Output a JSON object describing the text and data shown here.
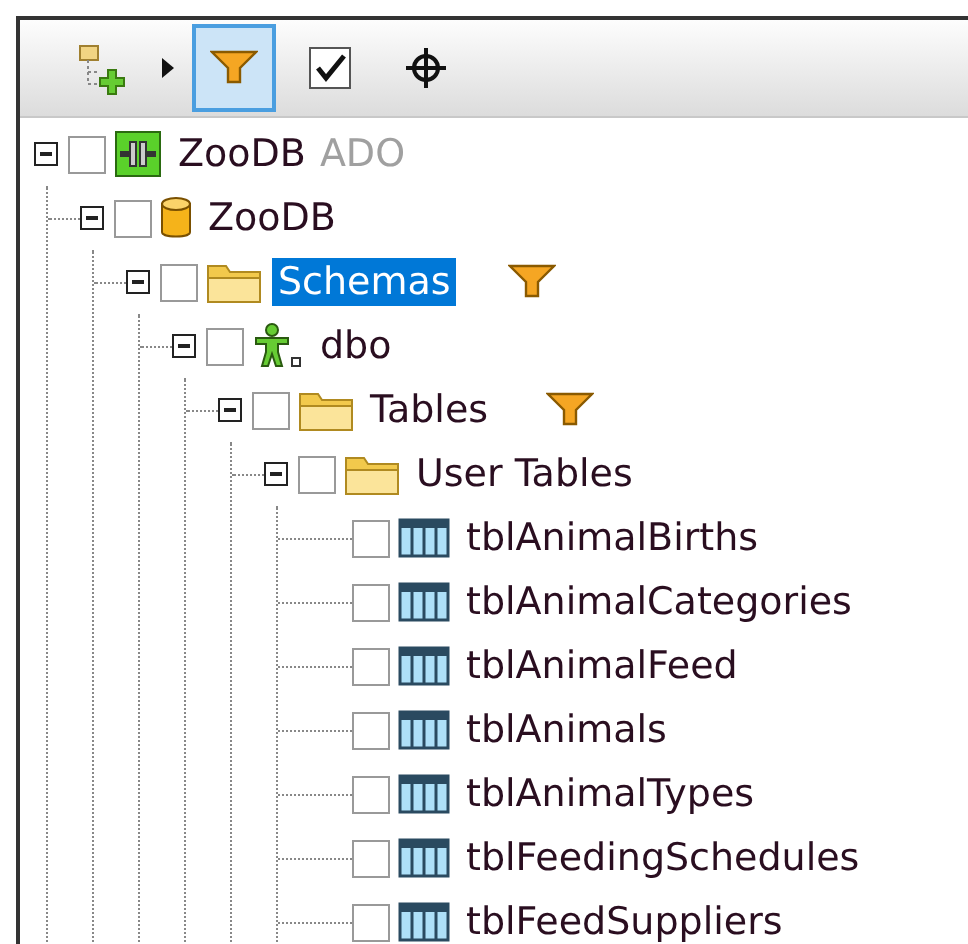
{
  "toolbar": [
    {
      "kind": "add-folder",
      "selected": false
    },
    {
      "kind": "dropdown",
      "selected": false
    },
    {
      "kind": "filter",
      "selected": true
    },
    {
      "kind": "check",
      "selected": false
    },
    {
      "kind": "locate",
      "selected": false
    }
  ],
  "tree": [
    {
      "kind": "connection",
      "label": "ZooDB",
      "suffix": "ADO",
      "expanded": true,
      "checked": false,
      "selected": false,
      "filtered": false,
      "children": [
        {
          "kind": "database",
          "label": "ZooDB",
          "expanded": true,
          "checked": false,
          "selected": false,
          "filtered": false,
          "children": [
            {
              "kind": "folder",
              "label": "Schemas",
              "expanded": true,
              "checked": false,
              "selected": true,
              "filtered": true,
              "children": [
                {
                  "kind": "schema",
                  "label": "dbo",
                  "expanded": true,
                  "checked": false,
                  "selected": false,
                  "filtered": false,
                  "children": [
                    {
                      "kind": "folder",
                      "label": "Tables",
                      "expanded": true,
                      "checked": false,
                      "selected": false,
                      "filtered": true,
                      "children": [
                        {
                          "kind": "folder",
                          "label": "User Tables",
                          "expanded": true,
                          "checked": false,
                          "selected": false,
                          "filtered": false,
                          "children": [
                            {
                              "kind": "table",
                              "label": "tblAnimalBirths",
                              "checked": false,
                              "selected": false,
                              "filtered": false
                            },
                            {
                              "kind": "table",
                              "label": "tblAnimalCategories",
                              "checked": false,
                              "selected": false,
                              "filtered": false
                            },
                            {
                              "kind": "table",
                              "label": "tblAnimalFeed",
                              "checked": false,
                              "selected": false,
                              "filtered": false
                            },
                            {
                              "kind": "table",
                              "label": "tblAnimals",
                              "checked": false,
                              "selected": false,
                              "filtered": false
                            },
                            {
                              "kind": "table",
                              "label": "tblAnimalTypes",
                              "checked": false,
                              "selected": false,
                              "filtered": false
                            },
                            {
                              "kind": "table",
                              "label": "tblFeedingSchedules",
                              "checked": false,
                              "selected": false,
                              "filtered": false
                            },
                            {
                              "kind": "table",
                              "label": "tblFeedSuppliers",
                              "checked": false,
                              "selected": false,
                              "filtered": false
                            }
                          ]
                        }
                      ]
                    }
                  ]
                }
              ]
            }
          ]
        }
      ]
    }
  ]
}
